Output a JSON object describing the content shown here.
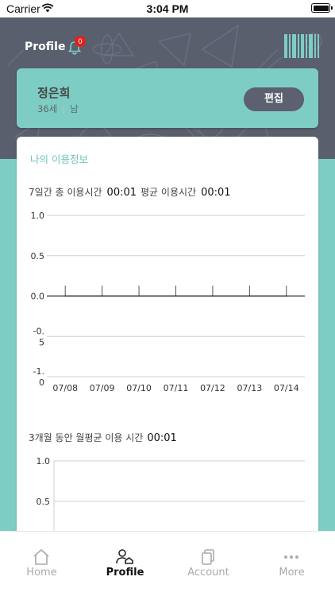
{
  "status_bar": {
    "carrier": "Carrier",
    "time": "3:04 PM"
  },
  "header": {
    "title": "Profile",
    "notification_count": "0"
  },
  "profile": {
    "name": "정은희",
    "age": "36세",
    "gender": "남",
    "edit_label": "편집"
  },
  "usage": {
    "section_title": "나의 이용정보",
    "weekly_total_label": "7일간 총 이용시간",
    "weekly_total_value": "00:01",
    "weekly_avg_label": "평균 이용시간",
    "weekly_avg_value": "00:01",
    "monthly_label": "3개월 동안 월평균 이용 시간",
    "monthly_value": "00:01"
  },
  "chart_data": [
    {
      "type": "line",
      "x": [
        "07/08",
        "07/09",
        "07/10",
        "07/11",
        "07/12",
        "07/13",
        "07/14"
      ],
      "ytick_labels": [
        "1.0",
        "0.5",
        "0.0",
        "-0.\n5",
        "-1.\n0"
      ],
      "ylim": [
        -1.0,
        1.0
      ],
      "series": [
        {
          "values": [
            0,
            0,
            0,
            0,
            0,
            0,
            0
          ]
        }
      ],
      "grid": true
    },
    {
      "type": "bar",
      "ytick_labels": [
        "1.0",
        "0.5"
      ],
      "ylim": [
        0,
        1.0
      ],
      "grid": true
    }
  ],
  "tabbar": {
    "items": [
      {
        "label": "Home",
        "icon": "home-icon",
        "active": false
      },
      {
        "label": "Profile",
        "icon": "profile-icon",
        "active": true
      },
      {
        "label": "Account",
        "icon": "account-icon",
        "active": false
      },
      {
        "label": "More",
        "icon": "more-icon",
        "active": false
      }
    ]
  }
}
